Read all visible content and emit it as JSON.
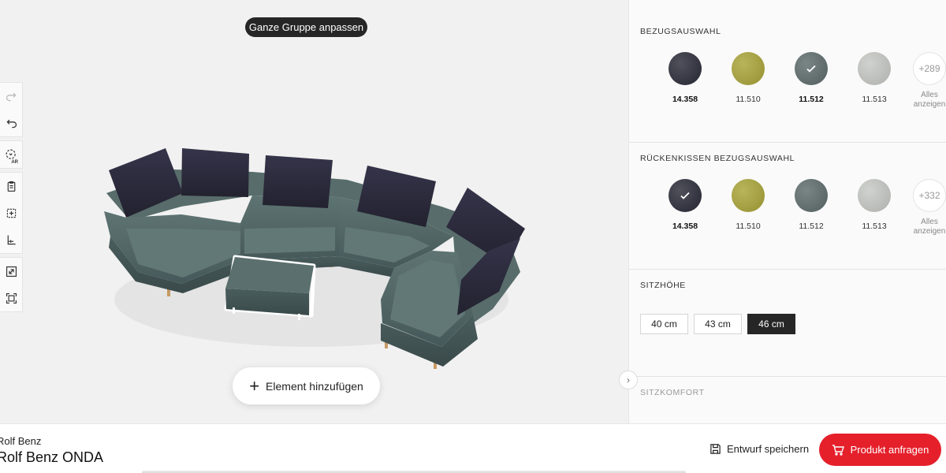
{
  "viewport": {
    "group_button": "Ganze Gruppe anpassen",
    "add_element": "Element hinzufügen",
    "toolbar": [
      "redo-icon",
      "undo-icon",
      "ar-view-icon",
      "clipboard-icon",
      "add-frame-icon",
      "measure-icon",
      "fullscreen-icon",
      "fit-view-icon"
    ],
    "ar_label": "AR",
    "colors": {
      "sofa": "#4f6462",
      "cushion": "#2c2b3b"
    }
  },
  "panel": {
    "fabric": {
      "title": "BEZUGSAUSWAHL",
      "swatches": [
        {
          "code": "14.358",
          "color": "#2a2a38",
          "selected": false
        },
        {
          "code": "11.510",
          "color": "#a9a437",
          "selected": false
        },
        {
          "code": "11.512",
          "color": "#5d6a6b",
          "selected": true
        },
        {
          "code": "11.513",
          "color": "#c6c8c4",
          "selected": false
        }
      ],
      "more_count": "+289",
      "more_label_1": "Alles",
      "more_label_2": "anzeigen"
    },
    "cushion": {
      "title": "RÜCKENKISSEN BEZUGSAUSWAHL",
      "swatches": [
        {
          "code": "14.358",
          "color": "#2a2a38",
          "selected": true
        },
        {
          "code": "11.510",
          "color": "#a9a437",
          "selected": false
        },
        {
          "code": "11.512",
          "color": "#5d6a6b",
          "selected": false
        },
        {
          "code": "11.513",
          "color": "#c6c8c4",
          "selected": false
        }
      ],
      "more_count": "+332",
      "more_label_1": "Alles",
      "more_label_2": "anzeigen"
    },
    "seat_height": {
      "title": "SITZHÖHE",
      "options": [
        "40 cm",
        "43 cm",
        "46 cm"
      ],
      "selected": "46 cm"
    },
    "comfort": {
      "title": "SITZKOMFORT"
    }
  },
  "bottom": {
    "brand": "Rolf Benz",
    "product": "Rolf Benz ONDA",
    "save_draft": "Entwurf speichern",
    "request": "Produkt anfragen",
    "accent": "#e5202b"
  }
}
